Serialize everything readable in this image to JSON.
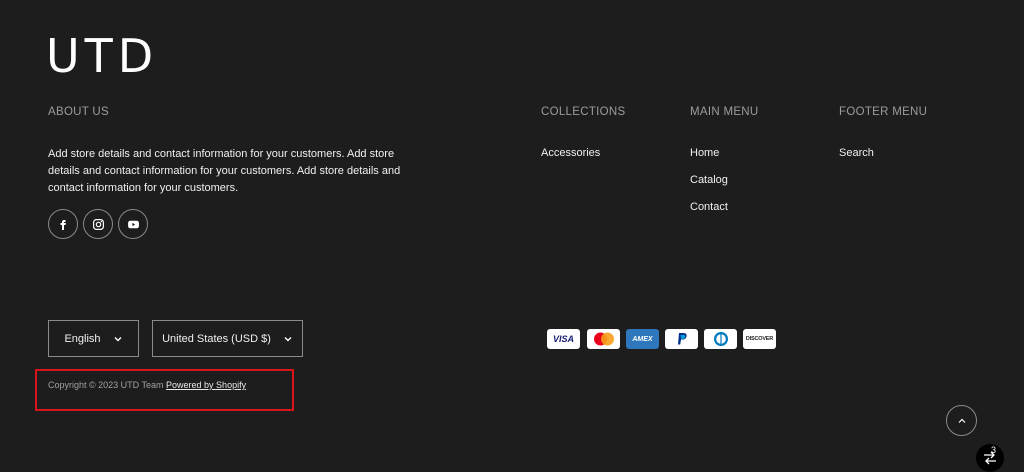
{
  "logo": "UTD",
  "about": {
    "heading": "ABOUT US",
    "text": "Add store details and contact information for your customers. Add store details and contact information for your customers. Add store details and contact information for your customers."
  },
  "social": [
    {
      "icon": "facebook-icon"
    },
    {
      "icon": "instagram-icon"
    },
    {
      "icon": "youtube-icon"
    }
  ],
  "collections": {
    "heading": "COLLECTIONS",
    "links": [
      "Accessories"
    ]
  },
  "main_menu": {
    "heading": "MAIN MENU",
    "links": [
      "Home",
      "Catalog",
      "Contact"
    ]
  },
  "footer_menu": {
    "heading": "FOOTER MENU",
    "links": [
      "Search"
    ]
  },
  "language": {
    "value": "English"
  },
  "currency": {
    "value": "United States (USD $)"
  },
  "payments": [
    "VISA",
    "mastercard",
    "AMEX",
    "PayPal",
    "diners",
    "DISCOVER"
  ],
  "copyright": {
    "text": "Copyright © 2023 UTD Team",
    "link": "Powered by Shopify"
  },
  "badge_count": "3",
  "colors": {
    "background": "#1e1d1e",
    "highlight": "#d9141b"
  }
}
